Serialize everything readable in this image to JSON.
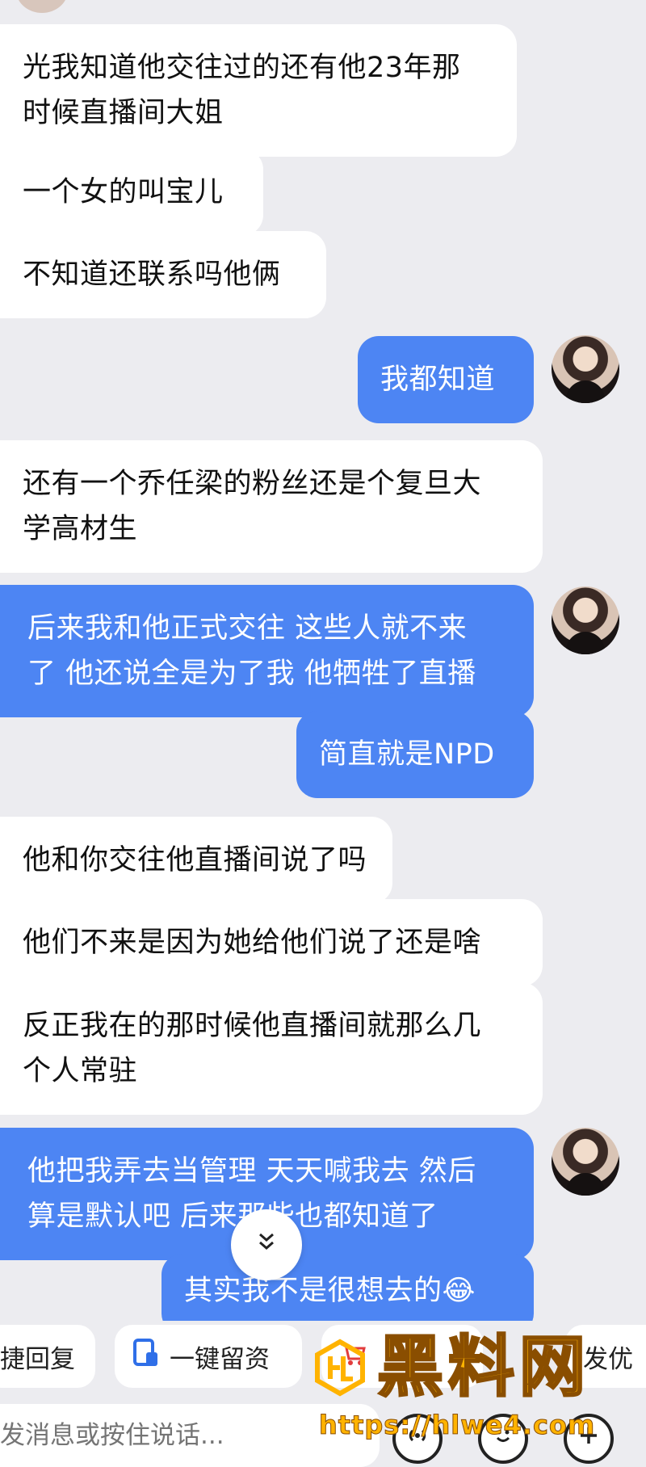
{
  "messages": [
    {
      "side": "in",
      "lines": [
        "光我知道他交往过的还有他23年那",
        "时候直播间大姐"
      ]
    },
    {
      "side": "in",
      "lines": [
        "一个女的叫宝儿"
      ]
    },
    {
      "side": "in",
      "lines": [
        "不知道还联系吗他俩"
      ]
    },
    {
      "side": "out",
      "lines": [
        "我都知道"
      ]
    },
    {
      "side": "in",
      "lines": [
        "还有一个乔任梁的粉丝还是个复旦大",
        "学高材生"
      ]
    },
    {
      "side": "out",
      "lines": [
        "后来我和他正式交往 这些人就不来",
        "了 他还说全是为了我 他牺牲了直播"
      ]
    },
    {
      "side": "out",
      "lines": [
        "简直就是NPD"
      ]
    },
    {
      "side": "in",
      "lines": [
        "他和你交往他直播间说了吗"
      ]
    },
    {
      "side": "in",
      "lines": [
        "他们不来是因为她给他们说了还是啥"
      ]
    },
    {
      "side": "in",
      "lines": [
        "反正我在的那时候他直播间就那么几",
        "个人常驻"
      ]
    },
    {
      "side": "out",
      "lines": [
        "他把我弄去当管理 天天喊我去 然后",
        "算是默认吧 后来那些也都知道了"
      ]
    },
    {
      "side": "out",
      "lines": [
        "其实我不是很想去的😂"
      ]
    }
  ],
  "icons": {
    "scroll_down": "chevron-double-down-icon",
    "voice": "voice-icon",
    "emoji": "emoji-icon",
    "plus": "plus-icon"
  },
  "quick_replies": {
    "chip1": "捷回复",
    "chip2": "一键留资",
    "chip4": "发优"
  },
  "input": {
    "placeholder": "发消息或按住说话..."
  },
  "watermark": {
    "title": "黑料网",
    "url": "https://hlwe4.com"
  },
  "colors": {
    "outgoing_bubble": "#4d85f3",
    "incoming_bubble": "#ffffff",
    "background": "#ececf0",
    "watermark": "#ffb300"
  }
}
